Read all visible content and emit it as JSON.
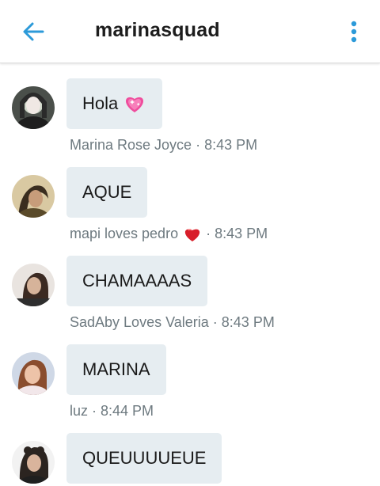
{
  "header": {
    "back_icon": "arrow-left-icon",
    "title": "marinasquad",
    "menu_icon": "more-vertical-icon",
    "accent_color": "#2c9ad9"
  },
  "messages": [
    {
      "text": "Hola",
      "emoji": "sparkling-heart",
      "author": "Marina Rose Joyce",
      "author_emoji": "",
      "time": "8:43 PM"
    },
    {
      "text": "AQUE",
      "emoji": "",
      "author": "mapi loves pedro",
      "author_emoji": "red-heart",
      "time": "8:43 PM"
    },
    {
      "text": "CHAMAAAAS",
      "emoji": "",
      "author": "SadAby Loves Valeria",
      "author_emoji": "",
      "time": "8:43 PM"
    },
    {
      "text": "MARINA",
      "emoji": "",
      "author": "luz",
      "author_emoji": "",
      "time": "8:44 PM"
    },
    {
      "text": "QUEUUUUEUE",
      "emoji": "",
      "author": "",
      "author_emoji": "",
      "time": ""
    }
  ],
  "colors": {
    "bubble": "#e6edf1",
    "meta_text": "#6e7a80",
    "title_text": "#1d1d1d"
  }
}
